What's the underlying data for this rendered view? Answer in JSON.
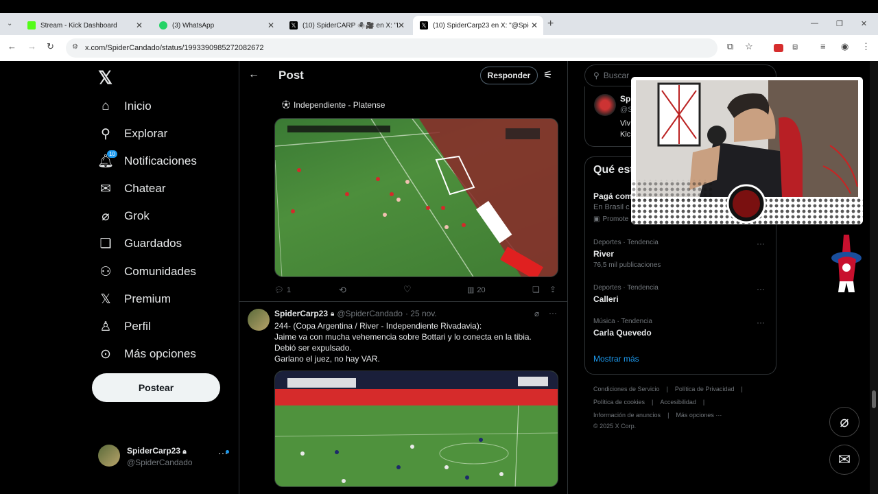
{
  "browser": {
    "tabs": [
      {
        "title": "Stream - Kick Dashboard",
        "color": "#53fc18"
      },
      {
        "title": "(3) WhatsApp",
        "color": "#25d366"
      },
      {
        "title": "(10) SpiderCARP 🕷️🎥 en X: \"L",
        "color": "#000000"
      },
      {
        "title": "(10) SpiderCarp23 en X: \"@Spid",
        "color": "#000000"
      }
    ],
    "new_tab": "+",
    "url": "x.com/SpiderCandado/status/1993390985272082672"
  },
  "nav": {
    "items": [
      {
        "label": "Inicio",
        "icon": "home-icon"
      },
      {
        "label": "Explorar",
        "icon": "search-icon"
      },
      {
        "label": "Notificaciones",
        "icon": "bell-icon",
        "badge": "10"
      },
      {
        "label": "Chatear",
        "icon": "mail-icon"
      },
      {
        "label": "Grok",
        "icon": "grok-icon"
      },
      {
        "label": "Guardados",
        "icon": "bookmark-icon"
      },
      {
        "label": "Comunidades",
        "icon": "communities-icon"
      },
      {
        "label": "Premium",
        "icon": "x-icon"
      },
      {
        "label": "Perfil",
        "icon": "person-icon"
      },
      {
        "label": "Más opciones",
        "icon": "more-icon"
      }
    ],
    "post_button": "Postear",
    "account_name": "SpiderCarp23",
    "account_handle": "@SpiderCandado"
  },
  "header": {
    "title": "Post",
    "respond_button": "Responder"
  },
  "tweet1": {
    "match_label": "Independiente - Platense",
    "replies": "1",
    "views": "20"
  },
  "tweet2": {
    "author": "SpiderCarp23",
    "handle": "@SpiderCandado",
    "date": "· 25 nov.",
    "lines": [
      "244- (Copa Argentina / River - Independiente Rivadavia):",
      "Jaime va con mucha vehemencia sobre Bottari y lo conecta en la tibia.",
      "Debió ser expulsado.",
      "Garlano el juez, no hay VAR."
    ]
  },
  "right": {
    "search_placeholder": "Buscar",
    "card_name": "Spi",
    "card_handle": "@S",
    "card_bio_1": "Viv",
    "card_bio_2": "Kic",
    "trends_title": "Qué est",
    "promo_name": "Pagá com",
    "promo_sub": "En Brasil c",
    "promo_tag": "Promote",
    "trends": [
      {
        "context": "Deportes · Tendencia",
        "name": "River",
        "count": "76,5 mil publicaciones"
      },
      {
        "context": "Deportes · Tendencia",
        "name": "Calleri",
        "count": ""
      },
      {
        "context": "Música · Tendencia",
        "name": "Carla Quevedo",
        "count": ""
      }
    ],
    "show_more": "Mostrar más",
    "footer": [
      [
        "Condiciones de Servicio",
        "Política de Privacidad"
      ],
      [
        "Política de cookies",
        "Accesibilidad"
      ],
      [
        "Información de anuncios",
        "Más opciones ···"
      ],
      [
        "© 2025 X Corp."
      ]
    ]
  },
  "colors": {
    "accent": "#1d9bf0",
    "background": "#000000",
    "muted": "#71767b"
  }
}
